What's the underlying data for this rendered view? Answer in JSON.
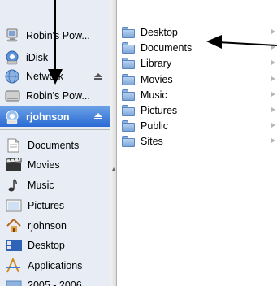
{
  "sidebar": {
    "devices": [
      {
        "label": "Robin's Pow...",
        "icon": "computer-icon",
        "eject": false
      },
      {
        "label": "iDisk",
        "icon": "idisk-icon",
        "eject": false
      },
      {
        "label": "Network",
        "icon": "network-icon",
        "eject": true
      },
      {
        "label": "Robin's Pow...",
        "icon": "hard-disk-icon",
        "eject": false
      },
      {
        "label": "rjohnson",
        "icon": "idisk-user-icon",
        "eject": true,
        "selected": true
      }
    ],
    "places": [
      {
        "label": "Documents",
        "icon": "documents-icon"
      },
      {
        "label": "Movies",
        "icon": "movies-icon"
      },
      {
        "label": "Music",
        "icon": "music-icon"
      },
      {
        "label": "Pictures",
        "icon": "pictures-icon"
      },
      {
        "label": "rjohnson",
        "icon": "home-icon"
      },
      {
        "label": "Desktop",
        "icon": "desktop-icon"
      },
      {
        "label": "Applications",
        "icon": "applications-icon"
      },
      {
        "label": "2005 - 2006",
        "icon": "folder-icon"
      }
    ]
  },
  "column": {
    "items": [
      "Desktop",
      "Documents",
      "Library",
      "Movies",
      "Music",
      "Pictures",
      "Public",
      "Sites"
    ]
  },
  "colors": {
    "selection": "#2a6ad4",
    "sidebar_bg": "#e8edf5",
    "folder_blue": "#7fa7d9"
  }
}
